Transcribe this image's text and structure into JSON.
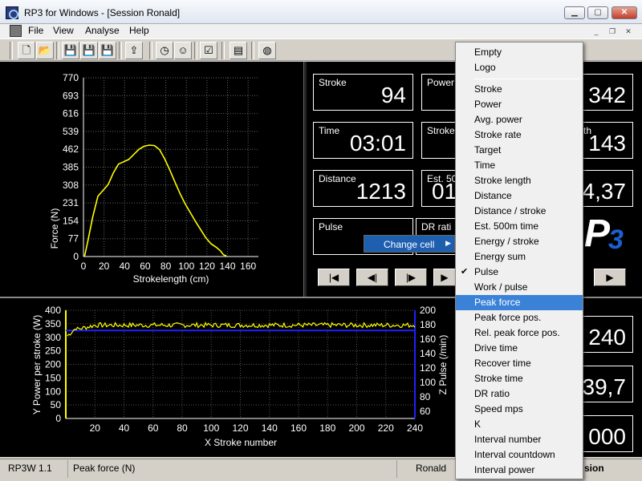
{
  "window": {
    "title": "RP3 for Windows - [Session Ronald]",
    "min_glyph": "▁",
    "max_glyph": "▢",
    "close_glyph": "✕"
  },
  "menubar": {
    "items": [
      "File",
      "View",
      "Analyse",
      "Help"
    ],
    "mdi_min": "_",
    "mdi_restore": "❐",
    "mdi_close": "✕"
  },
  "toolbar": {
    "icons": [
      "new-icon",
      "open-icon",
      "save-icon",
      "save-as-icon",
      "save-all-icon",
      "export-icon",
      "clock-icon",
      "user-icon",
      "checklist-icon",
      "chart-icon",
      "globe-icon"
    ]
  },
  "force_chart": {
    "xlabel": "Strokelength (cm)",
    "ylabel": "Force (N)",
    "x_ticks": [
      "0",
      "20",
      "40",
      "60",
      "80",
      "100",
      "120",
      "140",
      "160"
    ],
    "y_ticks": [
      "0",
      "77",
      "154",
      "231",
      "308",
      "385",
      "462",
      "539",
      "616",
      "693",
      "770"
    ],
    "xlim": [
      0,
      170
    ],
    "ylim": [
      0,
      770
    ]
  },
  "cells": [
    {
      "label": "Stroke",
      "value": "94"
    },
    {
      "label": "Power",
      "value": ""
    },
    {
      "label": "",
      "value": "342"
    },
    {
      "label": "Time",
      "value": "03:01"
    },
    {
      "label": "Stroke",
      "value": ""
    },
    {
      "label": "th",
      "value": "143"
    },
    {
      "label": "Distance",
      "value": "1213"
    },
    {
      "label": "Est. 500",
      "value": "01"
    },
    {
      "label": "",
      "value": "4,37"
    },
    {
      "label": "Pulse",
      "value": ""
    },
    {
      "label": "DR rati",
      "value": ""
    }
  ],
  "nav_buttons": [
    "|◀",
    "◀|",
    "|▶",
    "▶",
    "▶"
  ],
  "lower_cells": [
    {
      "value": "240"
    },
    {
      "value": "39,7"
    },
    {
      "value": "000"
    }
  ],
  "logo": {
    "letter": "P",
    "sub": "3"
  },
  "session_chart": {
    "xlabel": "X  Stroke number",
    "ylabel_left": "Y  Power per stroke (W)",
    "ylabel_right": "Z  Pulse (/min)",
    "x_ticks": [
      "20",
      "40",
      "60",
      "80",
      "100",
      "120",
      "140",
      "160",
      "180",
      "200",
      "220",
      "240"
    ],
    "y_left_ticks": [
      "0",
      "50",
      "100",
      "150",
      "200",
      "250",
      "300",
      "350",
      "400"
    ],
    "y_right_ticks": [
      "60",
      "80",
      "100",
      "120",
      "140",
      "160",
      "180",
      "200"
    ],
    "xlim": [
      0,
      240
    ],
    "ylim_left": [
      0,
      400
    ],
    "ylim_right": [
      50,
      200
    ]
  },
  "statusbar": {
    "version": "RP3W 1.1",
    "field": "Peak force (N)",
    "user": "Ronald",
    "right": "sion"
  },
  "context_menu": {
    "label": "Change cell",
    "arrow": "▶"
  },
  "submenu": {
    "top": [
      "Empty",
      "Logo"
    ],
    "items": [
      "Stroke",
      "Power",
      "Avg. power",
      "Stroke rate",
      "Target",
      "Time",
      "Stroke length",
      "Distance",
      "Distance / stroke",
      "Est. 500m time",
      "Energy / stroke",
      "Energy sum",
      "Pulse",
      "Work / pulse",
      "Peak force",
      "Peak force pos.",
      "Rel. peak force pos.",
      "Drive time",
      "Recover time",
      "Stroke time",
      "DR ratio",
      "Speed mps",
      "K",
      "Interval number",
      "Interval countdown",
      "Interval power"
    ],
    "checked": "Pulse",
    "highlighted": "Peak force",
    "check_glyph": "✔"
  },
  "colors": {
    "curve": "#ffff00",
    "pulse": "#2020ff",
    "highlight": "#3a81d8"
  }
}
